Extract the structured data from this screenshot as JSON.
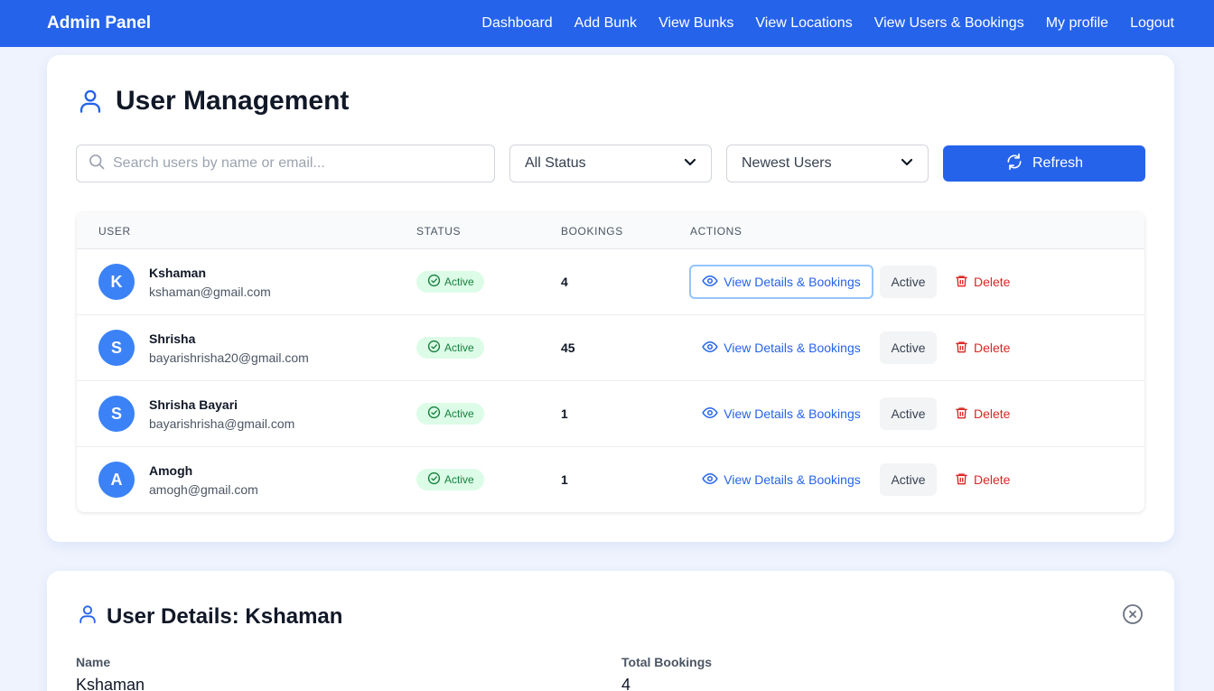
{
  "navbar": {
    "brand": "Admin Panel",
    "links": [
      "Dashboard",
      "Add Bunk",
      "View Bunks",
      "View Locations",
      "View Users & Bookings",
      "My profile",
      "Logout"
    ]
  },
  "main": {
    "title": "User Management",
    "search_placeholder": "Search users by name or email...",
    "status_filter": "All Status",
    "sort_filter": "Newest Users",
    "refresh_label": "Refresh",
    "columns": [
      "USER",
      "STATUS",
      "BOOKINGS",
      "ACTIONS"
    ],
    "rows": [
      {
        "initial": "K",
        "name": "Kshaman",
        "email": "kshaman@gmail.com",
        "status": "Active",
        "bookings": "4",
        "view_label": "View Details & Bookings",
        "toggle_label": "Active",
        "delete_label": "Delete"
      },
      {
        "initial": "S",
        "name": "Shrisha",
        "email": "bayarishrisha20@gmail.com",
        "status": "Active",
        "bookings": "45",
        "view_label": "View Details & Bookings",
        "toggle_label": "Active",
        "delete_label": "Delete"
      },
      {
        "initial": "S",
        "name": "Shrisha Bayari",
        "email": "bayarishrisha@gmail.com",
        "status": "Active",
        "bookings": "1",
        "view_label": "View Details & Bookings",
        "toggle_label": "Active",
        "delete_label": "Delete"
      },
      {
        "initial": "A",
        "name": "Amogh",
        "email": "amogh@gmail.com",
        "status": "Active",
        "bookings": "1",
        "view_label": "View Details & Bookings",
        "toggle_label": "Active",
        "delete_label": "Delete"
      }
    ]
  },
  "details": {
    "title": "User Details: Kshaman",
    "name_label": "Name",
    "name_value": "Kshaman",
    "bookings_label": "Total Bookings",
    "bookings_value": "4"
  },
  "colors": {
    "primary": "#2563eb",
    "avatar": "#3b82f6",
    "success_bg": "#dcfce7",
    "success_text": "#15803d",
    "danger": "#dc2626"
  },
  "icons": {
    "title": "user-icon",
    "search": "search-icon",
    "dropdown": "chevron-down-icon",
    "refresh": "refresh-icon",
    "status": "check-circle-icon",
    "view": "eye-icon",
    "delete": "trash-icon",
    "close": "close-circle-icon"
  }
}
